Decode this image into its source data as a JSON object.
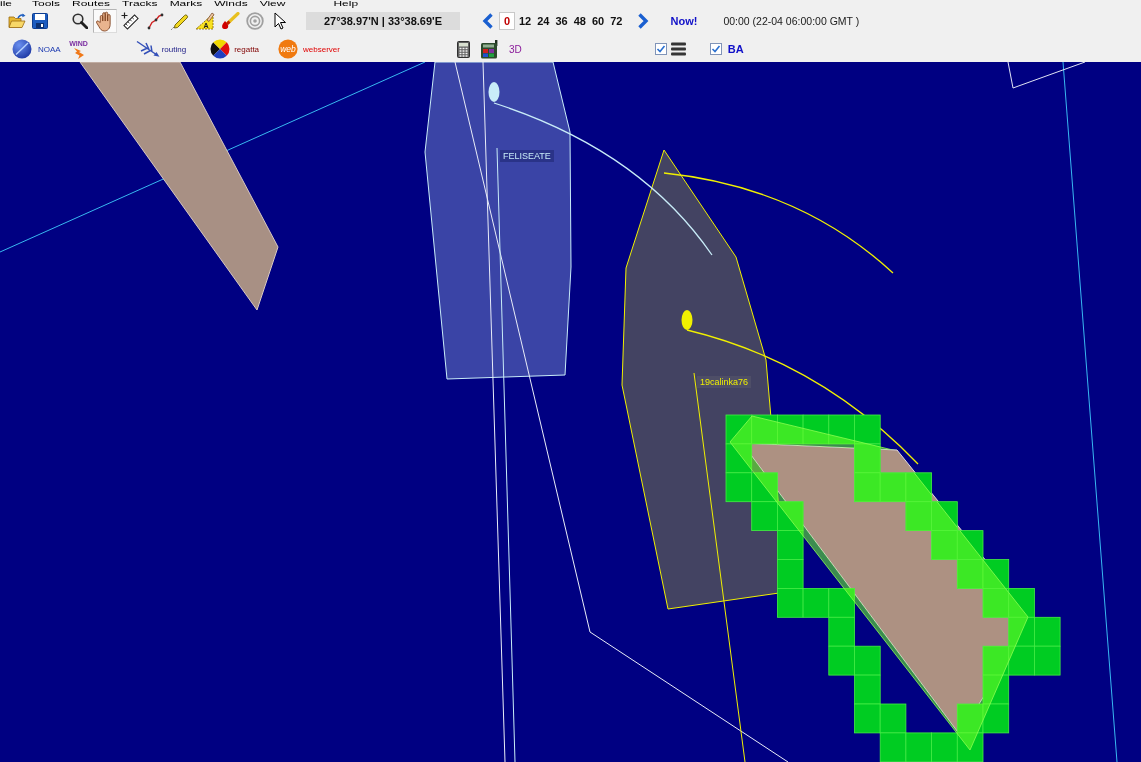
{
  "menu_bar": {
    "items": [
      "ile",
      "Tools",
      "Routes",
      "Tracks",
      "Marks",
      "Winds",
      "View",
      "Help"
    ]
  },
  "toolbar": {
    "file_buttons": [
      {
        "kind": "open"
      },
      {
        "kind": "save"
      }
    ],
    "tools": [
      {
        "kind": "zoom",
        "selected": false
      },
      {
        "kind": "pan",
        "selected": true
      },
      {
        "kind": "measure",
        "selected": false
      },
      {
        "kind": "route",
        "selected": false
      },
      {
        "kind": "pencil",
        "selected": false
      },
      {
        "kind": "area",
        "selected": false,
        "glyph": "A"
      },
      {
        "kind": "paint",
        "selected": false
      },
      {
        "kind": "target",
        "selected": false
      },
      {
        "kind": "pointer",
        "selected": false
      }
    ],
    "position": "27°38.97'N | 33°38.69'E",
    "forecast": {
      "hours": [
        {
          "label": "0",
          "selected": true
        },
        {
          "label": "12",
          "selected": false
        },
        {
          "label": "24",
          "selected": false
        },
        {
          "label": "36",
          "selected": false
        },
        {
          "label": "48",
          "selected": false
        },
        {
          "label": "60",
          "selected": false
        },
        {
          "label": "72",
          "selected": false
        }
      ],
      "now_button": "Now!",
      "time": "00:00 (22-04 06:00:00 GMT )"
    }
  },
  "services_bar": {
    "services": [
      {
        "kind": "noaa",
        "label": "NOAA"
      },
      {
        "kind": "wind",
        "glyph": "WIND"
      },
      {
        "kind": "routing",
        "label": "routing"
      },
      {
        "kind": "regatta",
        "label": "regatta"
      },
      {
        "kind": "web",
        "glyph": "web",
        "label": "webserver"
      }
    ],
    "tools": [
      {
        "kind": "calculator"
      },
      {
        "kind": "device"
      }
    ],
    "view_3d": "3D",
    "layers": [
      {
        "kind": "list",
        "checked": true
      },
      {
        "kind": "label",
        "label": "BA",
        "checked": true
      }
    ]
  },
  "map": {
    "boats": [
      {
        "name": "FELISEATE",
        "color": "#c8ecf8"
      },
      {
        "name": "19calinka76",
        "color": "#f0f000"
      }
    ]
  }
}
